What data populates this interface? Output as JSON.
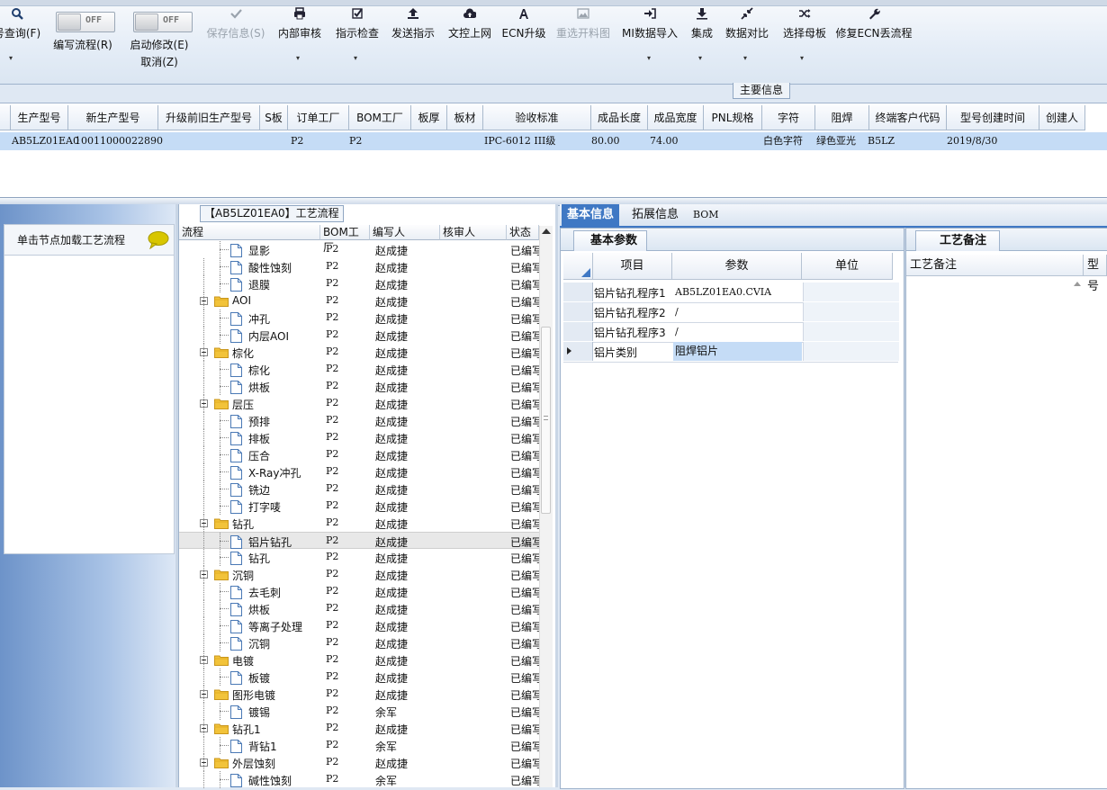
{
  "toolbar": {
    "items": [
      {
        "label": "号查询(F)",
        "icon": "search-icon",
        "enabled": true
      },
      {
        "label": "编写流程(R)",
        "icon": "toggle",
        "enabled": true
      },
      {
        "label": "启动修改(E)",
        "label2": "取消(Z)",
        "icon": "toggle",
        "enabled": true
      },
      {
        "label": "保存信息(S)",
        "icon": "check-icon",
        "enabled": false
      },
      {
        "label": "内部审核",
        "icon": "print-icon",
        "enabled": true
      },
      {
        "label": "指示检查",
        "icon": "checkbox-icon",
        "enabled": true
      },
      {
        "label": "发送指示",
        "icon": "upload-icon",
        "enabled": true
      },
      {
        "label": "文控上网",
        "icon": "cloud-upload-icon",
        "enabled": true
      },
      {
        "label": "ECN升级",
        "icon": "font-icon",
        "enabled": true
      },
      {
        "label": "重选开料图",
        "icon": "picture-icon",
        "enabled": false
      },
      {
        "label": "MI数据导入",
        "icon": "import-icon",
        "enabled": true
      },
      {
        "label": "集成",
        "icon": "download-icon",
        "enabled": true
      },
      {
        "label": "数据对比",
        "icon": "compress-icon",
        "enabled": true
      },
      {
        "label": "选择母板",
        "icon": "shuffle-icon",
        "enabled": true
      },
      {
        "label": "修复ECN丢流程",
        "icon": "wrench-icon",
        "enabled": true
      }
    ],
    "toggle_text": "OFF"
  },
  "main_info_label": "主要信息",
  "grid1": {
    "columns": [
      "生产型号",
      "新生产型号",
      "升级前旧生产型号",
      "S板",
      "订单工厂",
      "BOM工厂",
      "板厚",
      "板材",
      "验收标准",
      "成品长度",
      "成品宽度",
      "PNL规格",
      "字符",
      "阻焊",
      "终端客户代码",
      "型号创建时间",
      "创建人"
    ],
    "row": {
      "生产型号": "AB5LZ01EA0",
      "新生产型号": "10011000022890",
      "订单工厂": "P2",
      "BOM工厂": "P2",
      "验收标准": "IPC-6012 III级",
      "成品长度": "80.00",
      "成品宽度": "74.00",
      "字符": "白色字符",
      "阻焊": "绿色亚光",
      "终端客户代码": "B5LZ",
      "型号创建时间": "2019/8/30"
    }
  },
  "left_panel": {
    "hint": "单击节点加载工艺流程"
  },
  "flow": {
    "title": "【AB5LZ01EA0】工艺流程",
    "columns": [
      "流程",
      "BOM工厂",
      "编写人",
      "核审人",
      "状态"
    ],
    "rows": [
      {
        "name": "显影",
        "level": 2,
        "bom": "P2",
        "writer": "赵成捷",
        "status": "已编写"
      },
      {
        "name": "酸性蚀刻",
        "level": 2,
        "bom": "P2",
        "writer": "赵成捷",
        "status": "已编写"
      },
      {
        "name": "退膜",
        "level": 2,
        "bom": "P2",
        "writer": "赵成捷",
        "status": "已编写"
      },
      {
        "name": "AOI",
        "level": 1,
        "bom": "P2",
        "writer": "赵成捷",
        "status": "已编写"
      },
      {
        "name": "冲孔",
        "level": 2,
        "bom": "P2",
        "writer": "赵成捷",
        "status": "已编写"
      },
      {
        "name": "内层AOI",
        "level": 2,
        "bom": "P2",
        "writer": "赵成捷",
        "status": "已编写"
      },
      {
        "name": "棕化",
        "level": 1,
        "bom": "P2",
        "writer": "赵成捷",
        "status": "已编写"
      },
      {
        "name": "棕化",
        "level": 2,
        "bom": "P2",
        "writer": "赵成捷",
        "status": "已编写"
      },
      {
        "name": "烘板",
        "level": 2,
        "bom": "P2",
        "writer": "赵成捷",
        "status": "已编写"
      },
      {
        "name": "层压",
        "level": 1,
        "bom": "P2",
        "writer": "赵成捷",
        "status": "已编写"
      },
      {
        "name": "预排",
        "level": 2,
        "bom": "P2",
        "writer": "赵成捷",
        "status": "已编写"
      },
      {
        "name": "排板",
        "level": 2,
        "bom": "P2",
        "writer": "赵成捷",
        "status": "已编写"
      },
      {
        "name": "压合",
        "level": 2,
        "bom": "P2",
        "writer": "赵成捷",
        "status": "已编写"
      },
      {
        "name": "X-Ray冲孔",
        "level": 2,
        "bom": "P2",
        "writer": "赵成捷",
        "status": "已编写"
      },
      {
        "name": "铣边",
        "level": 2,
        "bom": "P2",
        "writer": "赵成捷",
        "status": "已编写"
      },
      {
        "name": "打字唛",
        "level": 2,
        "bom": "P2",
        "writer": "赵成捷",
        "status": "已编写"
      },
      {
        "name": "钻孔",
        "level": 1,
        "bom": "P2",
        "writer": "赵成捷",
        "status": "已编写"
      },
      {
        "name": "铝片钻孔",
        "level": 2,
        "bom": "P2",
        "writer": "赵成捷",
        "status": "已编写",
        "selected": true
      },
      {
        "name": "钻孔",
        "level": 2,
        "bom": "P2",
        "writer": "赵成捷",
        "status": "已编写"
      },
      {
        "name": "沉铜",
        "level": 1,
        "bom": "P2",
        "writer": "赵成捷",
        "status": "已编写"
      },
      {
        "name": "去毛刺",
        "level": 2,
        "bom": "P2",
        "writer": "赵成捷",
        "status": "已编写"
      },
      {
        "name": "烘板",
        "level": 2,
        "bom": "P2",
        "writer": "赵成捷",
        "status": "已编写"
      },
      {
        "name": "等离子处理",
        "level": 2,
        "bom": "P2",
        "writer": "赵成捷",
        "status": "已编写"
      },
      {
        "name": "沉铜",
        "level": 2,
        "bom": "P2",
        "writer": "赵成捷",
        "status": "已编写"
      },
      {
        "name": "电镀",
        "level": 1,
        "bom": "P2",
        "writer": "赵成捷",
        "status": "已编写"
      },
      {
        "name": "板镀",
        "level": 2,
        "bom": "P2",
        "writer": "赵成捷",
        "status": "已编写"
      },
      {
        "name": "图形电镀",
        "level": 1,
        "bom": "P2",
        "writer": "赵成捷",
        "status": "已编写"
      },
      {
        "name": "镀锡",
        "level": 2,
        "bom": "P2",
        "writer": "余军",
        "status": "已编写"
      },
      {
        "name": "钻孔1",
        "level": 1,
        "bom": "P2",
        "writer": "赵成捷",
        "status": "已编写"
      },
      {
        "name": "背钻1",
        "level": 2,
        "bom": "P2",
        "writer": "余军",
        "status": "已编写"
      },
      {
        "name": "外层蚀刻",
        "level": 1,
        "bom": "P2",
        "writer": "赵成捷",
        "status": "已编写"
      },
      {
        "name": "碱性蚀刻",
        "level": 2,
        "bom": "P2",
        "writer": "余军",
        "status": "已编写"
      }
    ]
  },
  "right_tabs": [
    "基本信息",
    "拓展信息",
    "BOM"
  ],
  "basic": {
    "subtab": "基本参数",
    "columns": [
      "项目",
      "参数",
      "单位"
    ],
    "rows": [
      {
        "item": "铝片钻孔程序1",
        "param": "AB5LZ01EA0.CVIA",
        "unit": ""
      },
      {
        "item": "铝片钻孔程序2",
        "param": "/",
        "unit": ""
      },
      {
        "item": "铝片钻孔程序3",
        "param": "/",
        "unit": ""
      },
      {
        "item": "铝片类别",
        "param": "阻焊铝片",
        "unit": "",
        "current": true
      }
    ]
  },
  "notes": {
    "subtab": "工艺备注",
    "columns": [
      "工艺备注",
      "型号"
    ]
  }
}
